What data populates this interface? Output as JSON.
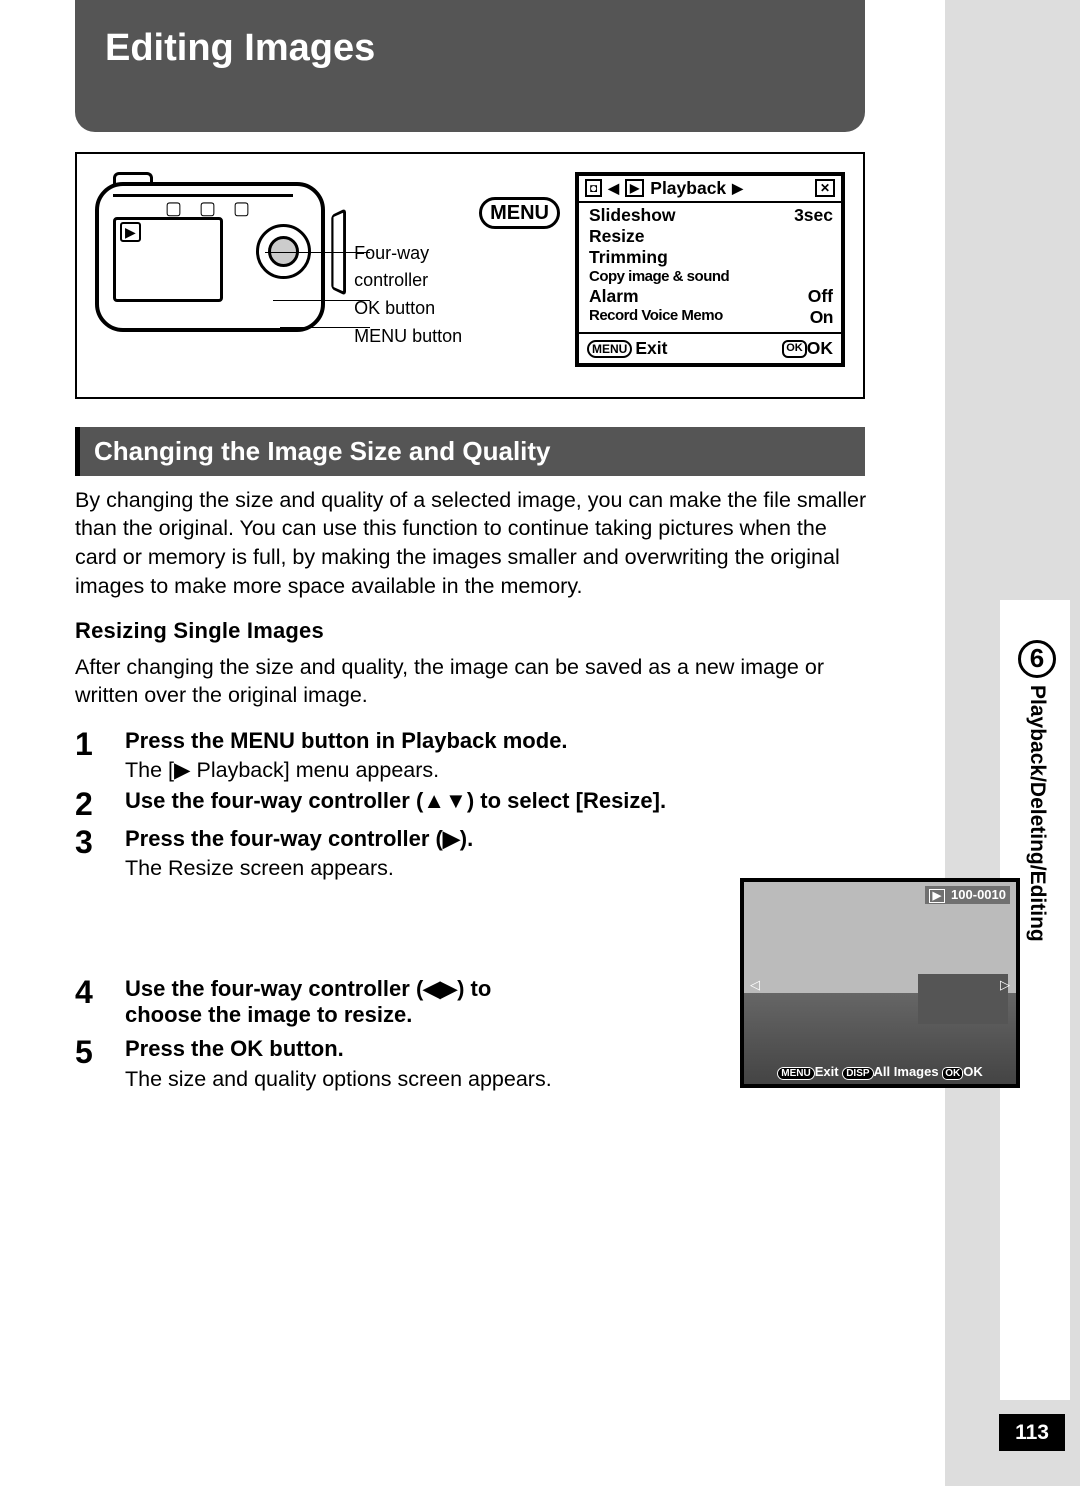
{
  "header": {
    "title": "Editing Images"
  },
  "figure": {
    "callouts": {
      "fourway": "Four-way\ncontroller",
      "ok": "OK button",
      "menu": "MENU button"
    },
    "menu_label": "MENU",
    "lcd": {
      "tab_icon1": "◘",
      "tab_icon2": "▶",
      "tab_title": "Playback",
      "tools_icon": "✕",
      "rows": [
        {
          "label": "Slideshow",
          "value": "3sec"
        },
        {
          "label": "Resize",
          "value": ""
        },
        {
          "label": "Trimming",
          "value": ""
        },
        {
          "label": "Copy image & sound",
          "value": ""
        },
        {
          "label": "Alarm",
          "value": "Off"
        },
        {
          "label": "Record Voice Memo",
          "value": "On"
        }
      ],
      "footer_left_pill": "MENU",
      "footer_left": "Exit",
      "footer_right_pill": "OK",
      "footer_right": "OK"
    }
  },
  "section_heading": "Changing the Image Size and Quality",
  "intro_text": "By changing the size and quality of a selected image, you can make the file smaller than the original. You can use this function to continue taking pictures when the card or memory is full, by making the images smaller and overwriting the original images to make more space available in the memory.",
  "sub_heading": "Resizing Single Images",
  "sub_text": "After changing the size and quality, the image can be saved as a new image or written over the original image.",
  "steps": [
    {
      "num": "1",
      "title": "Press the MENU button in Playback mode.",
      "body": "The [▶ Playback] menu appears."
    },
    {
      "num": "2",
      "title": "Use the four-way controller (▲▼) to select [Resize].",
      "body": ""
    },
    {
      "num": "3",
      "title": "Press the four-way controller (▶).",
      "body": "The Resize screen appears."
    },
    {
      "num": "4",
      "title": "Use the four-way controller (◀▶) to choose the image to resize.",
      "body": ""
    },
    {
      "num": "5",
      "title": "Press the OK button.",
      "body": "The size and quality options screen appears."
    }
  ],
  "resize_screenshot": {
    "counter": "100-0010",
    "bottom_menu": "MENU",
    "bottom_exit": "Exit",
    "bottom_disp": "DISP",
    "bottom_all": "All Images",
    "bottom_okpill": "OK",
    "bottom_ok": "OK"
  },
  "side": {
    "chapter_num": "6",
    "chapter_label": "Playback/Deleting/Editing"
  },
  "page_number": "113"
}
